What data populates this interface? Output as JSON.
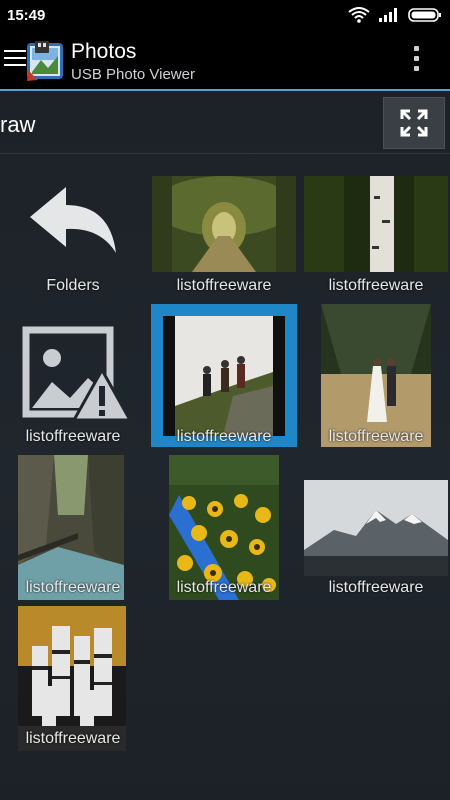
{
  "status_bar": {
    "time": "15:49"
  },
  "app_bar": {
    "title": "Photos",
    "subtitle": "USB Photo Viewer"
  },
  "path_bar": {
    "path": "raw"
  },
  "grid": {
    "items": [
      {
        "label": "Folders",
        "type": "folder-up"
      },
      {
        "label": "listoffreeware",
        "type": "photo",
        "description": "forest path"
      },
      {
        "label": "listoffreeware",
        "type": "photo",
        "description": "birch tree"
      },
      {
        "label": "listoffreeware",
        "type": "broken-image"
      },
      {
        "label": "listoffreeware",
        "type": "photo",
        "description": "hikers on rocks",
        "selected": true
      },
      {
        "label": "listoffreeware",
        "type": "photo",
        "description": "couple in field"
      },
      {
        "label": "listoffreeware",
        "type": "photo",
        "description": "canyon river"
      },
      {
        "label": "listoffreeware",
        "type": "photo",
        "description": "sunflowers"
      },
      {
        "label": "listoffreeware",
        "type": "photo",
        "description": "snowy mountains"
      },
      {
        "label": "listoffreeware",
        "type": "photo",
        "description": "camera lenses"
      }
    ]
  },
  "colors": {
    "accent": "#4fa3d6",
    "selection": "#1f86c7"
  }
}
